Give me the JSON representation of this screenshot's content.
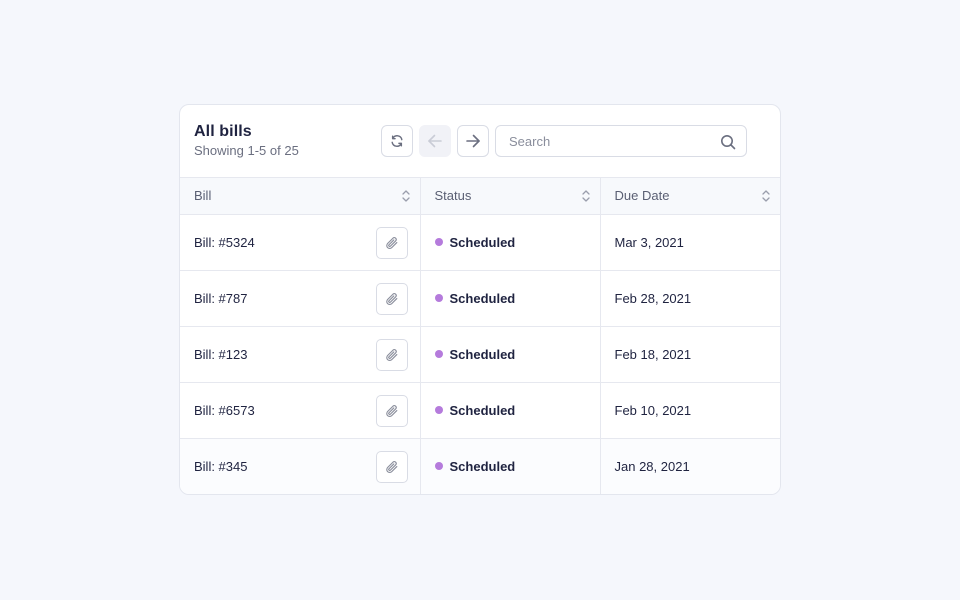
{
  "header": {
    "title": "All bills",
    "subtitle": "Showing 1-5 of 25"
  },
  "toolbar": {
    "refresh_icon": "refresh-icon",
    "prev_icon": "arrow-left-icon",
    "next_icon": "arrow-right-icon",
    "prev_disabled": true
  },
  "search": {
    "placeholder": "Search",
    "value": "",
    "icon": "search-icon"
  },
  "table": {
    "columns": [
      {
        "label": "Bill",
        "sortable": true
      },
      {
        "label": "Status",
        "sortable": true
      },
      {
        "label": "Due Date",
        "sortable": true
      }
    ],
    "rows": [
      {
        "bill": "Bill: #5324",
        "status": "Scheduled",
        "due": "Mar 3, 2021"
      },
      {
        "bill": "Bill: #787",
        "status": "Scheduled",
        "due": "Feb 28, 2021"
      },
      {
        "bill": "Bill: #123",
        "status": "Scheduled",
        "due": "Feb 18, 2021"
      },
      {
        "bill": "Bill: #6573",
        "status": "Scheduled",
        "due": "Feb 10, 2021"
      },
      {
        "bill": "Bill: #345",
        "status": "Scheduled",
        "due": "Jan 28, 2021"
      }
    ]
  },
  "colors": {
    "page_bg": "#f5f7fc",
    "text_primary": "#1f2340",
    "text_secondary": "#6b6f80",
    "status_scheduled": "#b57bdc",
    "border": "#e6e8ef"
  }
}
